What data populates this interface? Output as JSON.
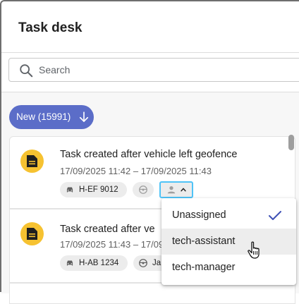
{
  "header": {
    "title": "Task desk"
  },
  "search": {
    "placeholder": "Search",
    "value": ""
  },
  "filter": {
    "new_label": "New (15991)"
  },
  "tasks": [
    {
      "title": "Task created after vehicle left geofence",
      "time": "17/09/2025 11:42 – 17/09/2025 11:43",
      "plate": "H-EF 9012"
    },
    {
      "title": "Task created after ve",
      "time": "17/09/2025 11:43 – 17/09",
      "plate": "H-AB 1234",
      "driver_partial": "Ja"
    }
  ],
  "assignee_menu": {
    "items": [
      {
        "label": "Unassigned",
        "selected": true
      },
      {
        "label": "tech-assistant",
        "hovered": true
      },
      {
        "label": "tech-manager"
      }
    ]
  },
  "icons": {
    "search": "search-icon",
    "sort_down": "arrow-down-icon",
    "task": "document-icon",
    "vehicle": "car-icon",
    "driver": "steering-wheel-icon",
    "assignee": "person-icon",
    "expand": "chevron-up-icon",
    "check": "check-icon",
    "cursor": "hand-pointer-icon"
  },
  "colors": {
    "accent": "#5b6dc8",
    "task_icon_bg": "#f6c231",
    "focus_outline": "#4fc3f7",
    "chip_bg": "#ececec"
  }
}
